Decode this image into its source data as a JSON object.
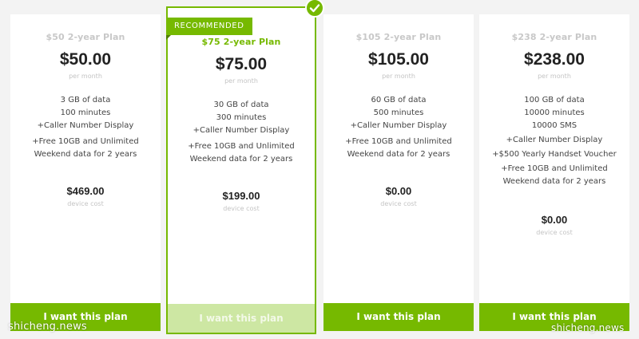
{
  "brand": {
    "accent": "#76b900",
    "accent_light": "#cde7a3"
  },
  "badge": {
    "label": "RECOMMENDED"
  },
  "plans": [
    {
      "name": "$50 2-year Plan",
      "price": "$50.00",
      "per": "per month",
      "features": [
        "3 GB of data",
        "100 minutes",
        "+Caller Number Display",
        "+Free 10GB and Unlimited",
        "Weekend data for 2 years"
      ],
      "device_price": "$469.00",
      "device_label": "device cost",
      "button": "I want this plan"
    },
    {
      "name": "$75 2-year Plan",
      "price": "$75.00",
      "per": "per month",
      "features": [
        "30 GB of data",
        "300 minutes",
        "+Caller Number Display",
        "+Free 10GB and Unlimited",
        "Weekend data for 2 years"
      ],
      "device_price": "$199.00",
      "device_label": "device cost",
      "button": "I want this plan",
      "recommended": true,
      "selected": true
    },
    {
      "name": "$105 2-year Plan",
      "price": "$105.00",
      "per": "per month",
      "features": [
        "60 GB of data",
        "500 minutes",
        "+Caller Number Display",
        "+Free 10GB and Unlimited",
        "Weekend data for 2 years"
      ],
      "device_price": "$0.00",
      "device_label": "device cost",
      "button": "I want this plan"
    },
    {
      "name": "$238 2-year Plan",
      "price": "$238.00",
      "per": "per month",
      "features": [
        "100 GB of data",
        "10000 minutes",
        "10000 SMS",
        "+Caller Number Display",
        "+$500 Yearly Handset Voucher",
        "+Free 10GB and Unlimited",
        "Weekend data for 2 years"
      ],
      "device_price": "$0.00",
      "device_label": "device cost",
      "button": "I want this plan"
    }
  ],
  "watermarks": {
    "left": "shicheng.news",
    "right": "shicheng.news"
  },
  "icons": {
    "selected": "check-icon"
  }
}
